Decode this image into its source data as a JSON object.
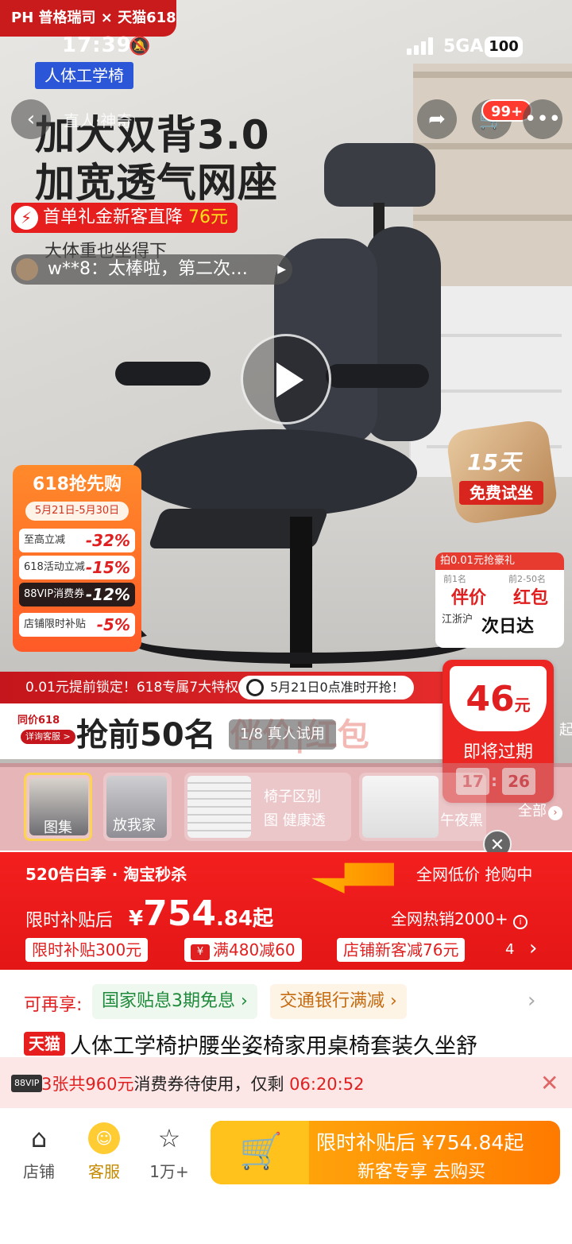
{
  "status_bar": {
    "time": "17:39",
    "network": "5GA",
    "battery": "100"
  },
  "brand_strip": "PH 普格瑞司 × 天猫618",
  "category_tag": "人体工学椅",
  "nav": {
    "back_icon": "chevron-left-icon",
    "title_overlay": "直人·神奇",
    "cart_badge": "99+"
  },
  "hero": {
    "headline_1": "加大双背3.0",
    "headline_2": "加宽透气网座",
    "promo_text": "首单礼金新客直降",
    "promo_amount": "76元",
    "subline": "大体重也坐得下",
    "review_text": "w**8：太棒啦，第二次…"
  },
  "panel_618": {
    "title": "618抢先购",
    "date": "5月21日-5月30日",
    "rows": [
      {
        "label": "至高立减",
        "value": "-32%"
      },
      {
        "label": "618活动立减",
        "value": "-15%"
      },
      {
        "label": "88VIP消费券",
        "value": "-12%"
      },
      {
        "label": "店铺限时补贴",
        "value": "-5%"
      }
    ]
  },
  "trial_badge": {
    "line1": "15天",
    "line2": "免费试坐"
  },
  "gift_panel": {
    "header": "拍0.01元抢豪礼",
    "a_label": "前1名",
    "b_label": "前2-50名",
    "a_value": "伴价",
    "b_value": "红包",
    "ship_label": "江浙沪",
    "ship_value": "次日达"
  },
  "hero_banner": {
    "lock_text": "0.01元提前锁定！618专属7大特权！",
    "time_text": "5月21日0点准时开抢！",
    "same_price": "同价618",
    "detail_label": "详询客服 >",
    "big_text": "抢前50名",
    "big_text_2": "伴价|红包",
    "counter": "1/8 真人试用",
    "edge_char": "起",
    "edge_yen": "¥"
  },
  "expiring_coupon": {
    "amount": "46",
    "unit": "元",
    "label": "即将过期",
    "hours": "17",
    "minutes": "26"
  },
  "thumbs": {
    "t1": "图集",
    "t2": "放我家",
    "t3a": "椅子区别",
    "t3b": "图 健康透",
    "t4": "午夜黑",
    "all": "全部"
  },
  "price_block": {
    "event": "520告白季 · 淘宝秒杀",
    "right_note": "全网低价 抢购中",
    "label": "限时补贴后",
    "yen": "¥",
    "int": "754",
    "dec": ".84",
    "suffix": "起",
    "sales": "全网热销2000+",
    "chips": [
      "限时补贴300元",
      "满480减60",
      "店铺新客减76元"
    ],
    "chip_more": "4"
  },
  "enjoy": {
    "label": "可再享:",
    "item1": "国家贴息3期免息 ›",
    "item2": "交通银行满减 ›"
  },
  "product": {
    "badge": "天猫",
    "title": "人体工学椅护腰坐姿椅家用桌椅套装久坐舒"
  },
  "notice": {
    "badge": "88VIP",
    "count": "3张共960元",
    "text": "消费券待使用，仅剩",
    "countdown": "06:20:52"
  },
  "bottom_bar": {
    "store": "店铺",
    "service": "客服",
    "favorites": "1万+",
    "buy_line1": "限时补贴后 ¥754.84起",
    "buy_line2": "新客专享 去购买"
  }
}
